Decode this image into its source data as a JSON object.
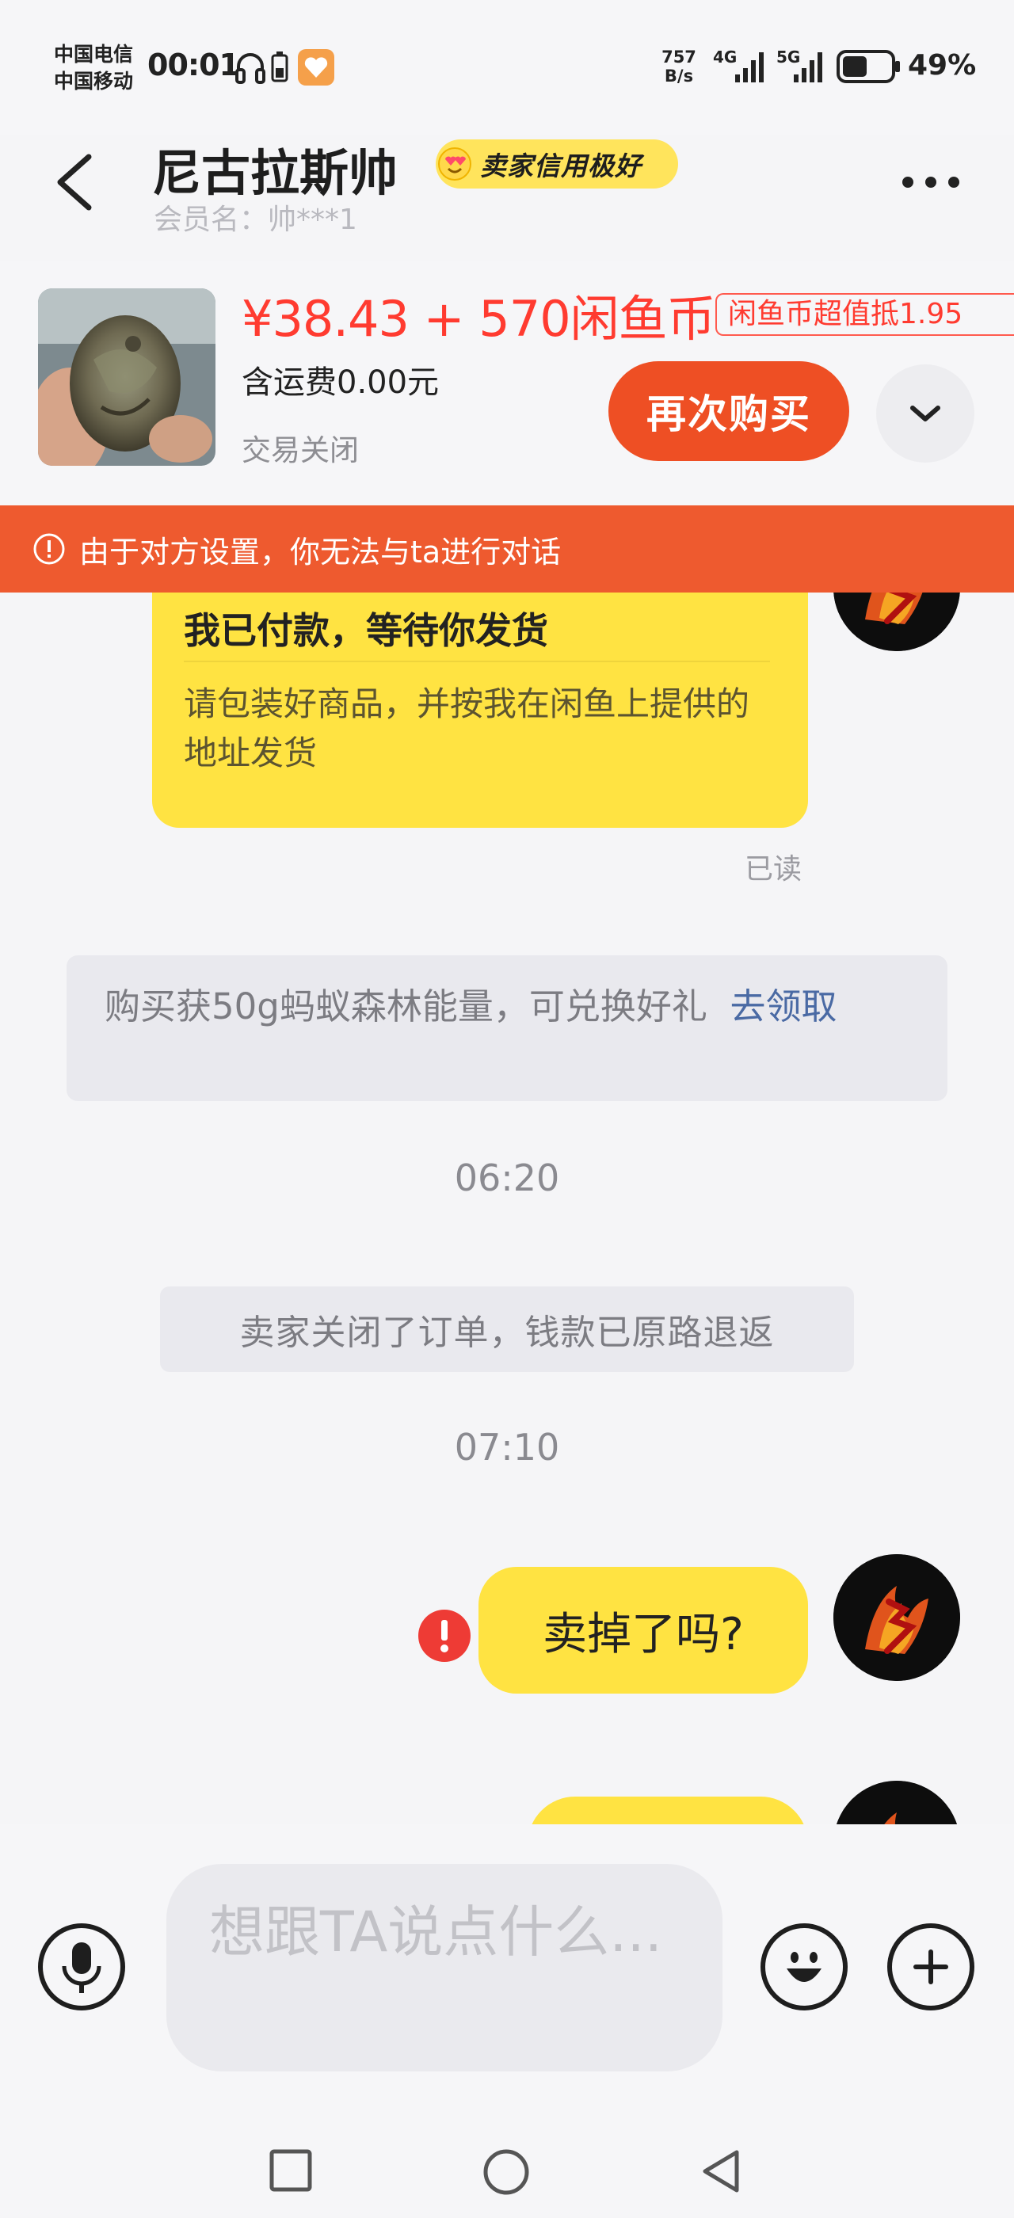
{
  "status_bar": {
    "carrier_1": "中国电信",
    "carrier_2": "中国移动",
    "time": "00:01",
    "net_speed_value": "757",
    "net_speed_unit": "B/s",
    "signal_1": "4G",
    "signal_2": "5G",
    "battery": "49%",
    "icons": [
      "headphones-icon",
      "battery-small-icon",
      "app-notification-icon",
      "signal-icon",
      "battery-icon"
    ]
  },
  "header": {
    "seller_name": "尼古拉斯帅",
    "credit_badge": "卖家信用极好",
    "member_name": "会员名：帅***1"
  },
  "order": {
    "price": "¥38.43 + 570闲鱼币",
    "coin_tag": "闲鱼币超值抵1.95",
    "shipping": "含运费0.00元",
    "status": "交易关闭",
    "rebuy_label": "再次购买"
  },
  "warning": {
    "text": "由于对方设置，你无法与ta进行对话"
  },
  "chat": {
    "paid_title": "我已付款，等待你发货",
    "paid_desc": "请包装好商品，并按我在闲鱼上提供的地址发货",
    "read_status": "已读",
    "promo_text": "购买获50g蚂蚁森林能量，可兑换好礼",
    "promo_link": "去领取",
    "time_1": "06:20",
    "system_notice": "卖家关闭了订单，钱款已原路退返",
    "time_2": "07:10",
    "message": "卖掉了吗?"
  },
  "input": {
    "placeholder": "想跟TA说点什么..."
  },
  "colors": {
    "accent_yellow": "#ffe342",
    "price_red": "#ff3b30",
    "banner_orange": "#ee5a2f",
    "rebuy_orange": "#ee4f24",
    "link_blue": "#4a6aa4"
  }
}
